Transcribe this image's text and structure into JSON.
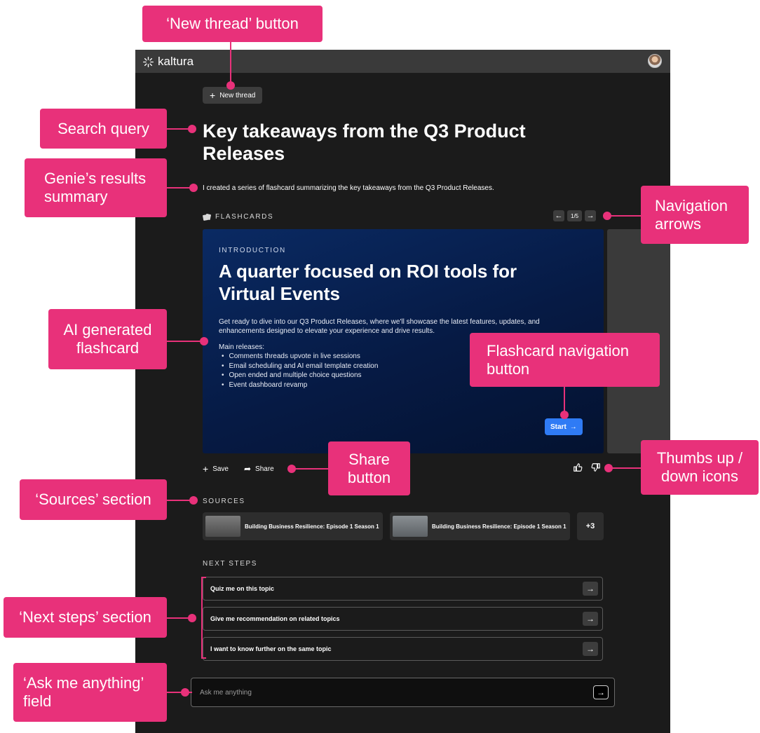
{
  "topbar": {
    "brand": "kaltura"
  },
  "new_thread": {
    "label": "New thread"
  },
  "query": "Key takeaways from the Q3 Product Releases",
  "summary": "I created a series of flashcard summarizing the key takeaways from the Q3 Product Releases.",
  "flashcards": {
    "label": "FLASHCARDS",
    "counter": "1/5",
    "card": {
      "eyebrow": "INTRODUCTION",
      "title": "A quarter focused on ROI tools for Virtual Events",
      "body": "Get ready to dive into our Q3 Product Releases, where we'll showcase the latest features, updates, and enhancements designed to elevate your experience and drive results.",
      "main_label": "Main releases:",
      "items": [
        "Comments threads upvote in live sessions",
        "Email scheduling and AI email template creation",
        "Open ended and multiple choice questions",
        "Event dashboard revamp"
      ],
      "start_label": "Start"
    }
  },
  "actions": {
    "save": "Save",
    "share": "Share"
  },
  "sources": {
    "label": "SOURCES",
    "items": [
      {
        "title": "Building Business Resilience: Episode 1 Season 1"
      },
      {
        "title": "Building Business Resilience: Episode 1 Season 1"
      }
    ],
    "more": "+3"
  },
  "next_steps": {
    "label": "NEXT STEPS",
    "items": [
      "Quiz me on this topic",
      "Give me recommendation on related topics",
      "I want to know further on the same topic"
    ]
  },
  "ask": {
    "placeholder": "Ask me anything"
  },
  "annotations": {
    "new_thread": "‘New thread’ button",
    "search_query": "Search  query",
    "genie_summary_1": "Genie’s results",
    "genie_summary_2": "summary",
    "nav_arrows_1": "Navigation",
    "nav_arrows_2": "arrows",
    "ai_flashcard_1": "AI generated",
    "ai_flashcard_2": "flashcard",
    "flashcard_nav_1": "Flashcard navigation",
    "flashcard_nav_2": "button",
    "share_1": "Share",
    "share_2": "button",
    "thumbs_1": "Thumbs up /",
    "thumbs_2": "down icons",
    "sources": "‘Sources’ section",
    "next_steps": "‘Next steps’ section",
    "ask_1": "‘Ask me anything’",
    "ask_2": "field"
  },
  "colors": {
    "accent": "#e8317a",
    "app_bg": "#1b1b1b",
    "card_bg": "#0a2a63",
    "start": "#2f7bf5"
  }
}
